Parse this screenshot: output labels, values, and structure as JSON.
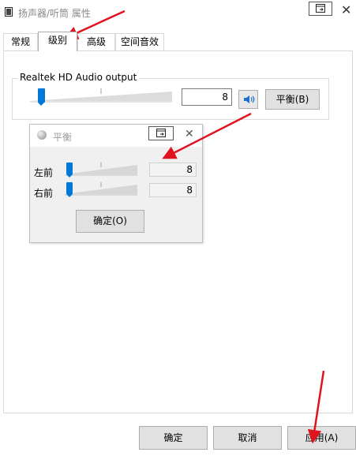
{
  "window": {
    "title": "扬声器/听筒 属性",
    "close_glyph": "✕"
  },
  "tabs": [
    {
      "label": "常规",
      "active": false
    },
    {
      "label": "级别",
      "active": true
    },
    {
      "label": "高级",
      "active": false
    },
    {
      "label": "空间音效",
      "active": false
    }
  ],
  "levels": {
    "device_label": "Realtek HD Audio output",
    "volume_value": "8",
    "volume_fraction": 0.08,
    "balance_button": "平衡(B)",
    "speaker_icon": "speaker-icon"
  },
  "balance_dialog": {
    "title": "平衡",
    "close_glyph": "✕",
    "channels": [
      {
        "label": "左前",
        "value": "8"
      },
      {
        "label": "右前",
        "value": "8"
      }
    ],
    "ok_button": "确定(O)"
  },
  "footer": {
    "ok": "确定",
    "cancel": "取消",
    "apply": "应用(A)"
  },
  "colors": {
    "accent": "#0078d7",
    "annotation_arrow": "#e0141e",
    "button_face": "#e1e1e1"
  }
}
